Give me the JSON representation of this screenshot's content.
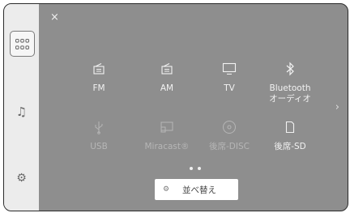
{
  "sidebar": {
    "menu_icon": "grid-icon",
    "music_icon": "music-note-icon",
    "settings_icon": "gear-icon"
  },
  "header": {
    "close_icon": "close-icon",
    "close_glyph": "×"
  },
  "sources": [
    {
      "label": "FM",
      "icon": "radio-icon",
      "enabled": true
    },
    {
      "label": "AM",
      "icon": "radio-icon",
      "enabled": true
    },
    {
      "label": "TV",
      "icon": "tv-icon",
      "enabled": true
    },
    {
      "label": "Bluetooth\nオーディオ",
      "icon": "bluetooth-icon",
      "enabled": true
    },
    {
      "label": "USB",
      "icon": "usb-icon",
      "enabled": false
    },
    {
      "label": "Miracast®",
      "icon": "miracast-icon",
      "enabled": false
    },
    {
      "label": "後席-DISC",
      "icon": "disc-icon",
      "enabled": false
    },
    {
      "label": "後席-SD",
      "icon": "sd-card-icon",
      "enabled": true
    }
  ],
  "pagination": {
    "pages": 2,
    "current": 1
  },
  "next_page_icon": "chevron-right-icon",
  "next_glyph": "›",
  "sort_button": {
    "label": "並べ替え",
    "icon": "gear-icon"
  },
  "colors": {
    "background": "#8e8e8e",
    "sidebar": "#ececec",
    "text": "#f2f2f2",
    "disabled": "#b6b6b6"
  }
}
